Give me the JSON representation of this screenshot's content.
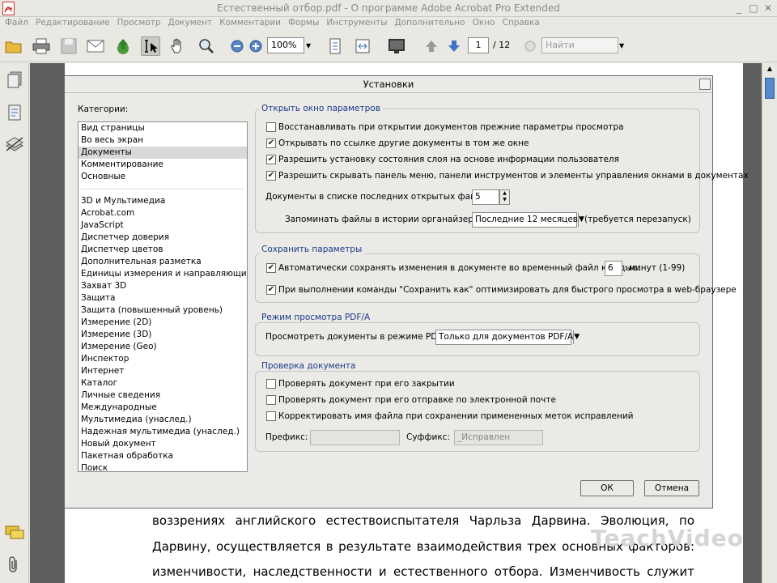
{
  "window": {
    "title": "Естественный отбор.pdf - О программе Adobe Acrobat Pro Extended"
  },
  "menu": [
    "Файл",
    "Редактирование",
    "Просмотр",
    "Документ",
    "Комментарии",
    "Формы",
    "Инструменты",
    "Дополнительно",
    "Окно",
    "Справка"
  ],
  "toolbar": {
    "zoom": "100%",
    "page_current": "1",
    "page_total": "/ 12",
    "find_placeholder": "Найти"
  },
  "document": {
    "lines": [
      "воззрениях английского естествоиспытателя Чарльза Дарвина. Эволюция, по",
      "Дарвину, осуществляется в результате взаимодействия трех основных факторов:",
      "изменчивости, наследственности и естественного отбора. Изменчивость служит"
    ],
    "watermark": "TeachVideo"
  },
  "dialog": {
    "title": "Установки",
    "categories_label": "Категории:",
    "categories_top": [
      "Вид страницы",
      "Во весь экран",
      "Документы",
      "Комментирование",
      "Основные"
    ],
    "categories_rest": [
      "3D и Мультимедиа",
      "Acrobat.com",
      "JavaScript",
      "Диспетчер доверия",
      "Диспетчер цветов",
      "Дополнительная разметка",
      "Единицы измерения и направляющие",
      "Захват 3D",
      "Защита",
      "Защита (повышенный уровень)",
      "Измерение (2D)",
      "Измерение (3D)",
      "Измерение (Geo)",
      "Инспектор",
      "Интернет",
      "Каталог",
      "Личные сведения",
      "Международные",
      "Мультимедиа (унаслед.)",
      "Надежная мультимедиа (унаслед.)",
      "Новый документ",
      "Пакетная обработка",
      "Поиск"
    ],
    "selected_category": "Документы",
    "open_group": {
      "title": "Открыть окно параметров",
      "options": [
        {
          "label": "Восстанавливать при открытии документов прежние параметры просмотра",
          "checked": false
        },
        {
          "label": "Открывать по ссылке другие документы в том же окне",
          "checked": true
        },
        {
          "label": "Разрешить установку состояния слоя на основе информации пользователя",
          "checked": true
        },
        {
          "label": "Разрешить скрывать панель меню, панели инструментов и элементы управления окнами в документах",
          "checked": true
        }
      ],
      "recent_label": "Документы в списке последних открытых файлов:",
      "recent_value": "5",
      "history_label": "Запоминать файлы в истории органайзера за:",
      "history_value": "Последние 12 месяцев",
      "restart_note": "(требуется перезапуск)"
    },
    "save_group": {
      "title": "Сохранить параметры",
      "autosave_label": "Автоматически сохранять изменения в документе во временный файл каждые:",
      "autosave_checked": true,
      "autosave_value": "6",
      "autosave_unit": "минут (1-99)",
      "optimize_label": "При выполнении команды \"Сохранить как\" оптимизировать для быстрого просмотра в web-браузере",
      "optimize_checked": true
    },
    "pdfa_group": {
      "title": "Режим просмотра PDF/A",
      "label": "Просмотреть документы в режиме PDF/A:",
      "value": "Только для документов PDF/A"
    },
    "check_group": {
      "title": "Проверка документа",
      "options": [
        {
          "label": "Проверять документ при его закрытии",
          "checked": false
        },
        {
          "label": "Проверять документ при его отправке по электронной почте",
          "checked": false
        },
        {
          "label": "Корректировать имя файла при сохранении примененных меток исправлений",
          "checked": false
        }
      ],
      "prefix_label": "Префикс:",
      "prefix_value": "",
      "suffix_label": "Суффикс:",
      "suffix_value": "_Исправлен"
    },
    "ok_label": "ОК",
    "cancel_label": "Отмена"
  }
}
